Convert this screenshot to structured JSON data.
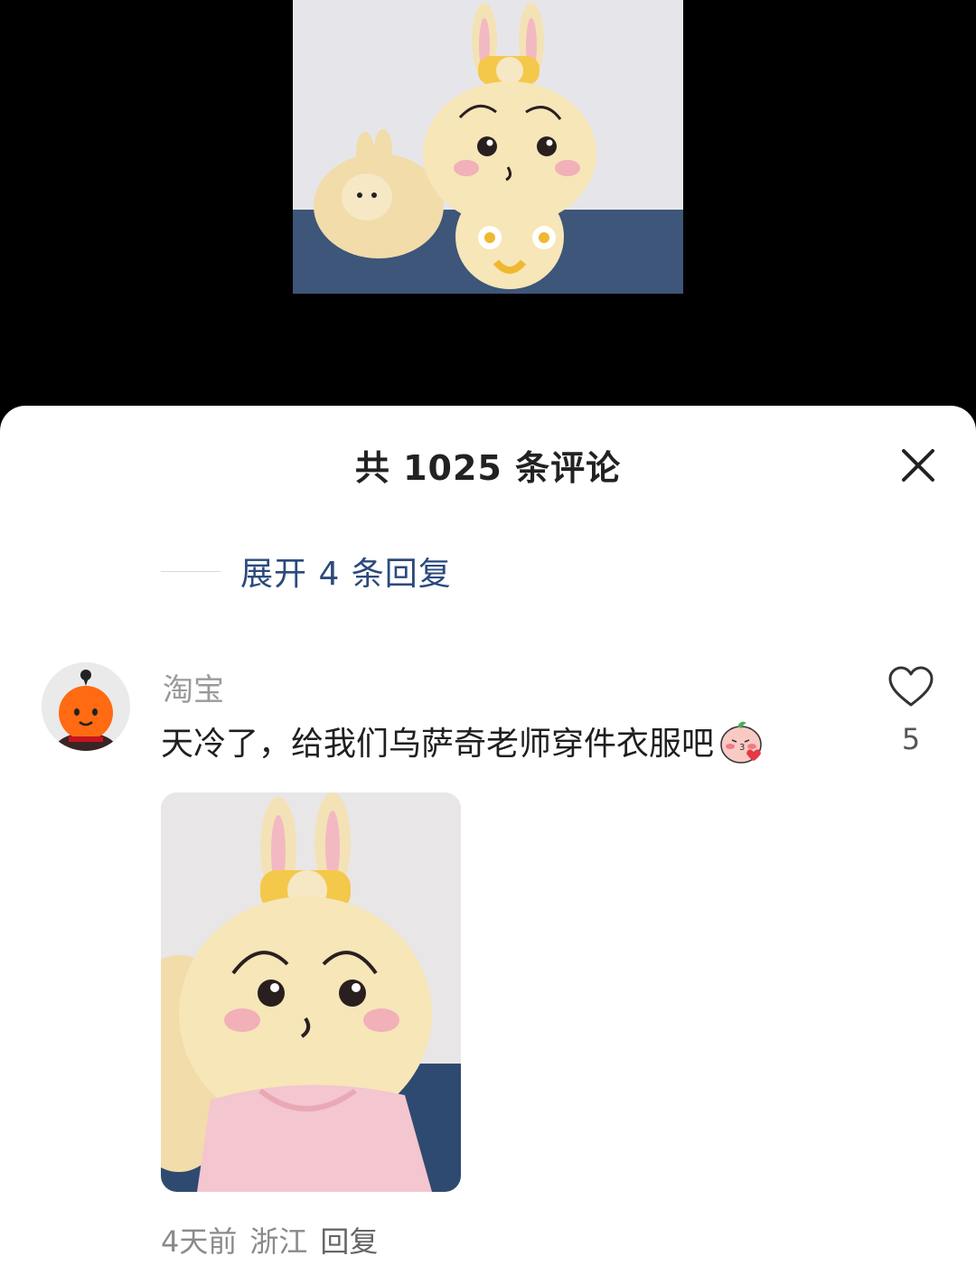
{
  "sheet": {
    "title": "共 1025 条评论",
    "close_icon": "close-icon"
  },
  "thread": {
    "expand_label": "展开 4 条回复"
  },
  "comment": {
    "username": "淘宝",
    "avatar_icon": "orange-mascot-avatar",
    "text": "天冷了，给我们乌萨奇老师穿件衣服吧",
    "emoji_icon": "blushing-peach-emoji",
    "like_icon": "heart-outline-icon",
    "like_count": "5",
    "time": "4天前",
    "location": "浙江",
    "reply_label": "回复"
  },
  "colors": {
    "accent_link": "#2b4a7c",
    "meta_gray": "#8a8a8a",
    "sheet_bg": "#ffffff",
    "backdrop": "#000000"
  }
}
